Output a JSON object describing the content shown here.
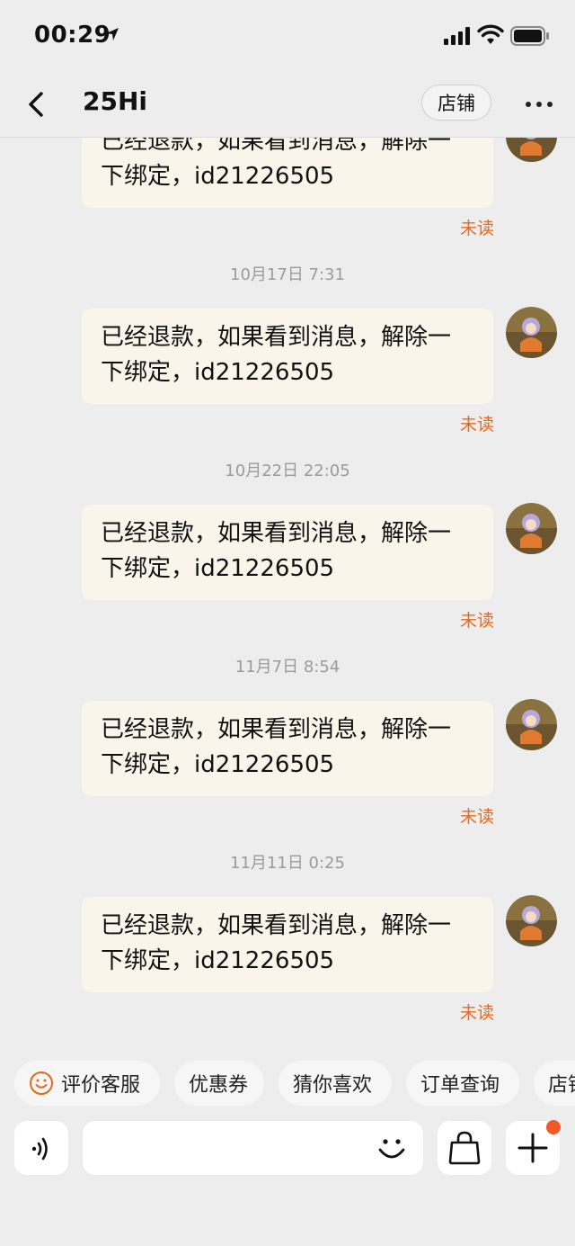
{
  "status_bar": {
    "time": "00:29",
    "icons": [
      "location-arrow-icon",
      "signal-icon",
      "wifi-icon",
      "battery-icon"
    ]
  },
  "nav": {
    "back_icon": "chevron-left-icon",
    "title": "25Hi",
    "shop_button": "店铺",
    "more_icon": "more-dots-icon"
  },
  "messages": [
    {
      "timestamp": "",
      "text_line1": "已经退款，如果看到消息，解除一",
      "text_line2": "下绑定，id21226505",
      "status": "未读"
    },
    {
      "timestamp": "10月17日 7:31",
      "text_line1": "已经退款，如果看到消息，解除一",
      "text_line2": "下绑定，id21226505",
      "status": "未读"
    },
    {
      "timestamp": "10月22日 22:05",
      "text_line1": "已经退款，如果看到消息，解除一",
      "text_line2": "下绑定，id21226505",
      "status": "未读"
    },
    {
      "timestamp": "11月7日 8:54",
      "text_line1": "已经退款，如果看到消息，解除一",
      "text_line2": "下绑定，id21226505",
      "status": "未读"
    },
    {
      "timestamp": "11月11日 0:25",
      "text_line1": "已经退款，如果看到消息，解除一",
      "text_line2": "下绑定，id21226505",
      "status": "未读"
    }
  ],
  "quick_replies": [
    {
      "label": "评价客服",
      "icon": "smile-icon"
    },
    {
      "label": "优惠券"
    },
    {
      "label": "猜你喜欢"
    },
    {
      "label": "订单查询"
    },
    {
      "label": "店铺"
    }
  ],
  "input_bar": {
    "voice_icon": "voice-icon",
    "message_placeholder": "",
    "emoji_icon": "emoji-icon",
    "shop_bag_icon": "shopping-bag-icon",
    "plus_icon": "plus-icon"
  },
  "colors": {
    "background": "#ededed",
    "bubble": "#faf5ea",
    "unread": "#e8691e",
    "badge": "#f05a28"
  }
}
